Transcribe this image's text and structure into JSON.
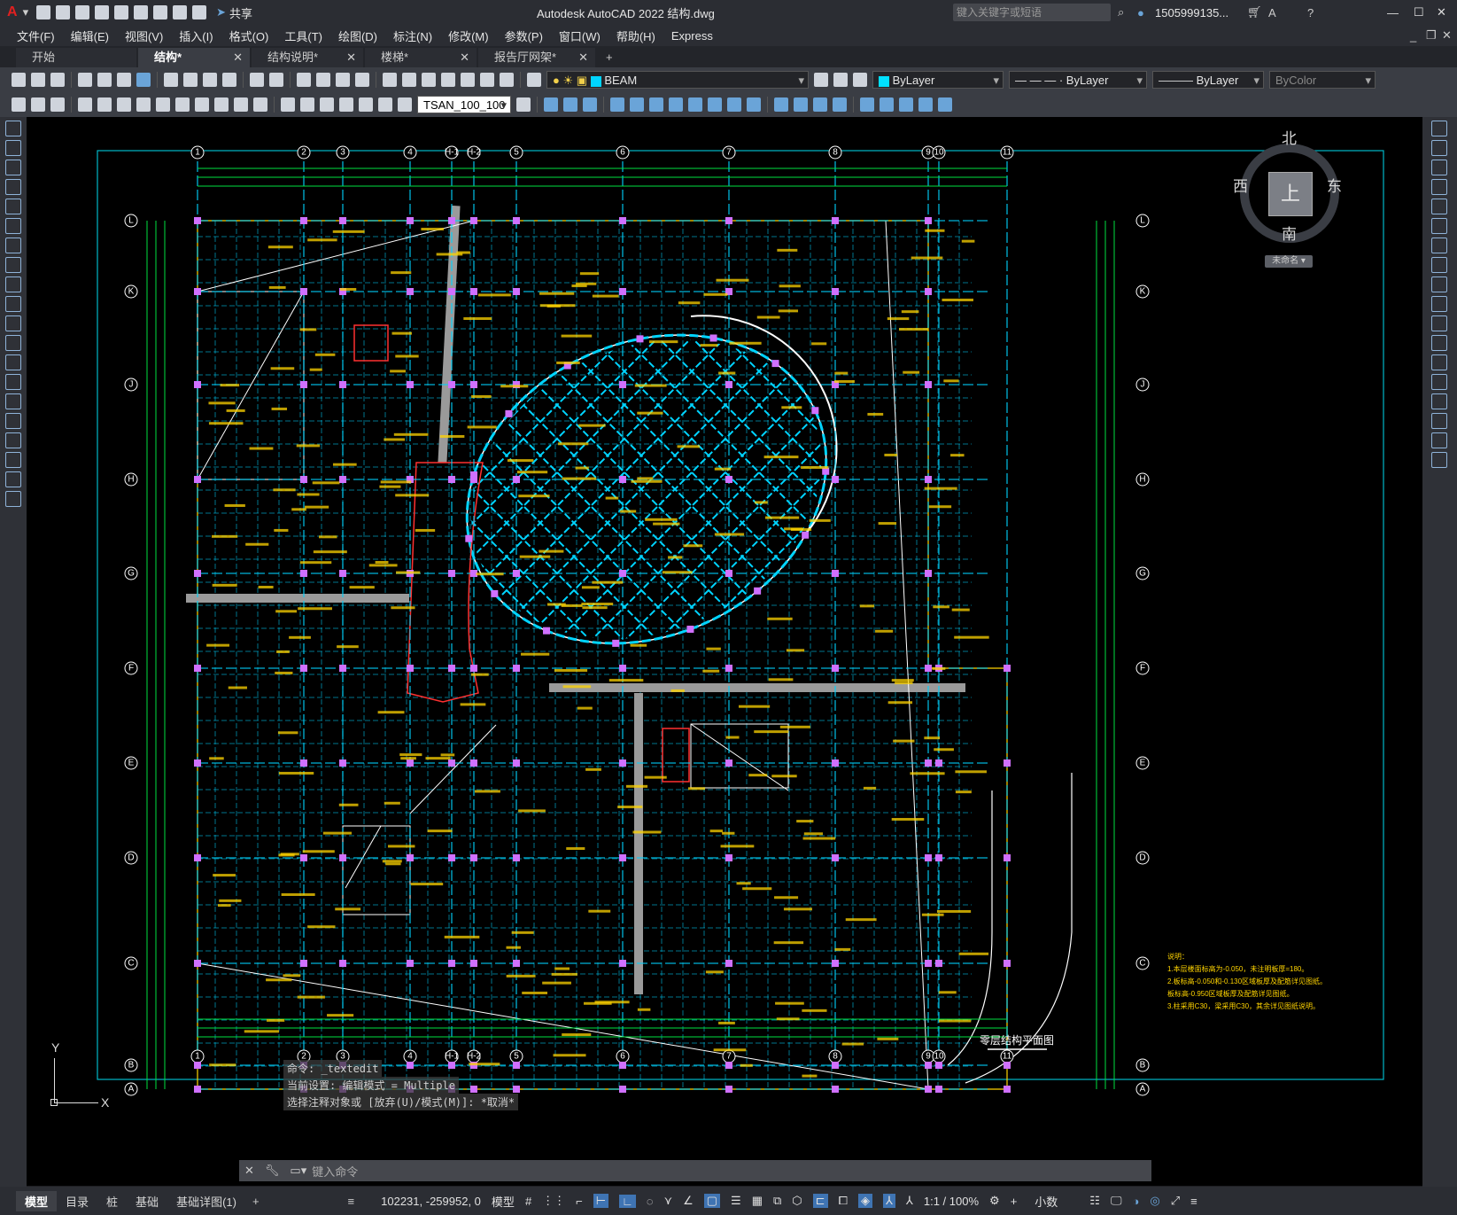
{
  "app": {
    "title": "Autodesk AutoCAD 2022    结构.dwg",
    "share_label": "共享",
    "search_placeholder": "键入关键字或短语",
    "user_name": "1505999135..."
  },
  "menu": [
    "文件(F)",
    "编辑(E)",
    "视图(V)",
    "插入(I)",
    "格式(O)",
    "工具(T)",
    "绘图(D)",
    "标注(N)",
    "修改(M)",
    "参数(P)",
    "窗口(W)",
    "帮助(H)",
    "Express"
  ],
  "tabs": [
    {
      "label": "开始",
      "closable": false
    },
    {
      "label": "结构*",
      "closable": true,
      "active": true
    },
    {
      "label": "结构说明*",
      "closable": true
    },
    {
      "label": "楼梯*",
      "closable": true
    },
    {
      "label": "报告厅网架*",
      "closable": true
    }
  ],
  "toolbar": {
    "layer_name": "BEAM",
    "color": "ByLayer",
    "linetype": "— — — · ByLayer",
    "lineweight": "ByLayer",
    "plotstyle": "ByColor",
    "textstyle": "TSAN_100_100"
  },
  "viewcube": {
    "north": "北",
    "south": "南",
    "east": "东",
    "west": "西",
    "top": "上",
    "ucs": "未命名"
  },
  "drawing": {
    "title": "零层结构平面图",
    "top_axes": [
      "1",
      "2",
      "3",
      "4",
      "H-1",
      "H-2",
      "5",
      "6",
      "7",
      "8",
      "9",
      "10",
      "11"
    ],
    "side_axes": [
      "L",
      "K",
      "J",
      "H",
      "G",
      "F",
      "E",
      "D",
      "C",
      "B",
      "A"
    ],
    "notes": [
      "说明：",
      "1.本层楼面标高为-0.050，未注明板厚=180。",
      "2.板标高-0.050和-0.130区域板厚及配筋详见图纸。",
      "  板标高-0.950区域板厚及配筋详见图纸。",
      "3.柱采用C30，梁采用C30，其余详见图纸说明。"
    ]
  },
  "ucs_icon": {
    "y": "Y",
    "x": "X"
  },
  "command": {
    "history": [
      "命令: _textedit",
      "当前设置: 编辑模式 = Multiple",
      "选择注释对象或 [放弃(U)/模式(M)]: *取消*"
    ],
    "placeholder": "键入命令"
  },
  "layout_tabs": [
    "模型",
    "目录",
    "桩",
    "基础",
    "基础详图(1)"
  ],
  "status": {
    "coords": "102231, -259952, 0",
    "space": "模型",
    "scale": "1:1 / 100%",
    "units": "小数"
  },
  "colors": {
    "grid": "#00e040",
    "beam": "#00d4ff",
    "text": "#ffd400",
    "column": "#d070ff",
    "frame": "#ffffff"
  }
}
